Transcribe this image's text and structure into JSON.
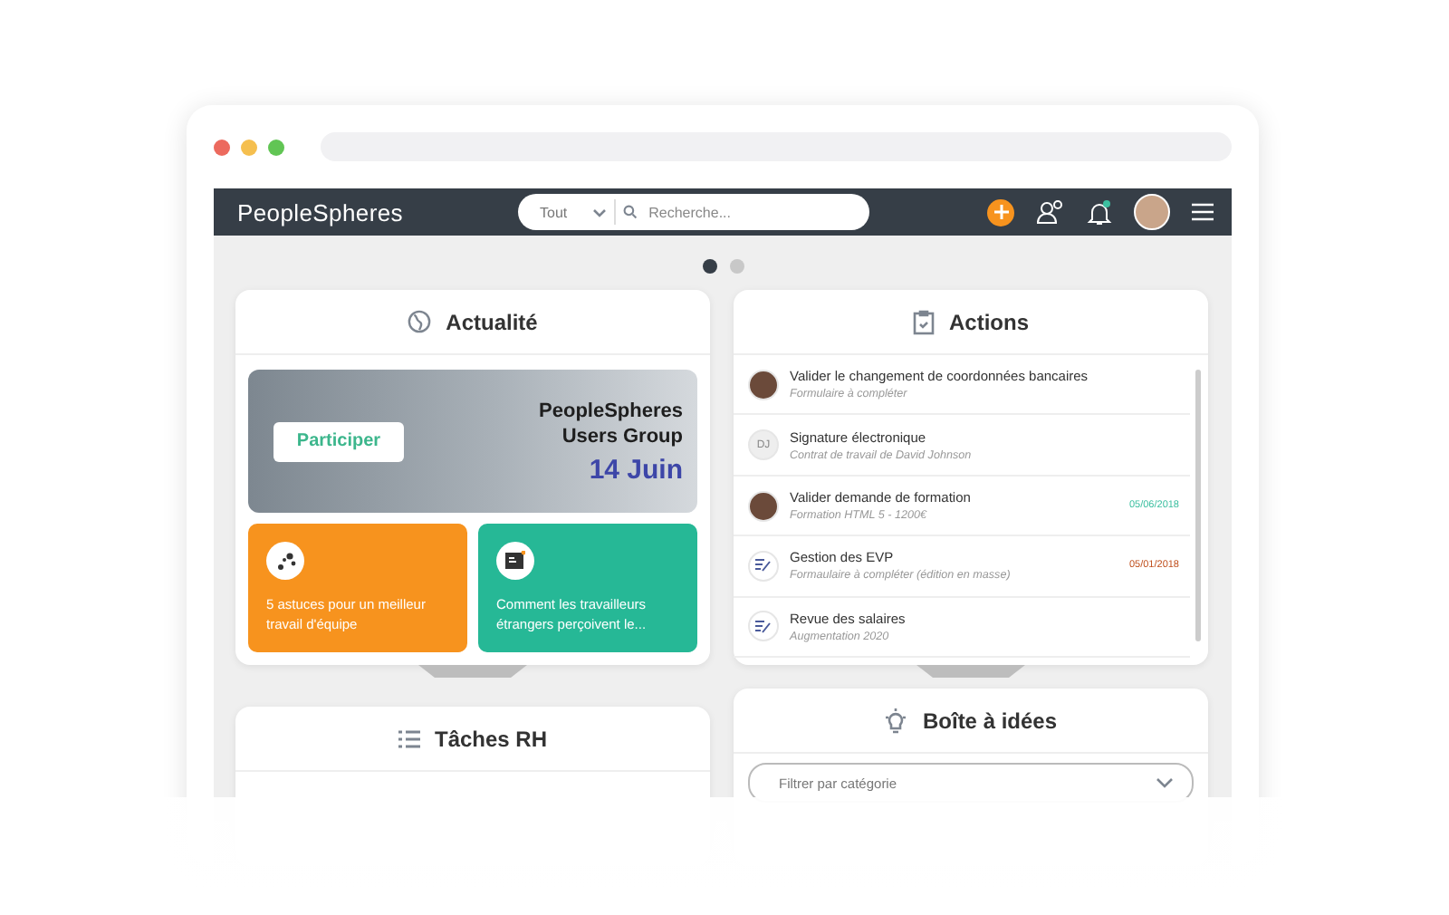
{
  "header": {
    "logo": "PeopleSpheres",
    "search_scope": "Tout",
    "search": {
      "placeholder": "Recherche..."
    },
    "notification_dot": true
  },
  "carousel": [
    {
      "selected": true
    },
    {
      "selected": false
    }
  ],
  "news": {
    "title": "Actualité",
    "banner": {
      "button": "Participer",
      "title": "PeopleSpheres Users Group",
      "date": "14 Juin"
    },
    "tiles": [
      {
        "text": "5 astuces pour un meilleur travail d'équipe",
        "color": "#f7931e",
        "kind": "network"
      },
      {
        "text": "Comment les travailleurs étrangers perçoivent le...",
        "color": "#26b896",
        "kind": "document"
      }
    ]
  },
  "actions": {
    "title": "Actions",
    "items": [
      {
        "kind": "photo",
        "title": "Valider le changement de coordonnées bancaires",
        "subtitle": "Formulaire à compléter"
      },
      {
        "kind": "initials",
        "initials": "DJ",
        "title": "Signature électronique",
        "subtitle": "Contrat de travail de David Johnson"
      },
      {
        "kind": "photo",
        "title": "Valider demande de formation",
        "subtitle": "Formation HTML 5 - 1200€",
        "date": "05/06/2018",
        "color": "#3cbfa0"
      },
      {
        "kind": "form",
        "title": "Gestion des EVP",
        "subtitle": "Formaulaire à compléter (édition en masse)",
        "date": "05/01/2018",
        "color": "#c0501e"
      },
      {
        "kind": "form",
        "title": "Revue des salaires",
        "subtitle": "Augmentation 2020"
      }
    ]
  },
  "hr_tasks": {
    "title": "Tâches RH"
  },
  "ideas": {
    "title": "Boîte à idées",
    "filter": {
      "placeholder": "Filtrer par catégorie"
    }
  }
}
